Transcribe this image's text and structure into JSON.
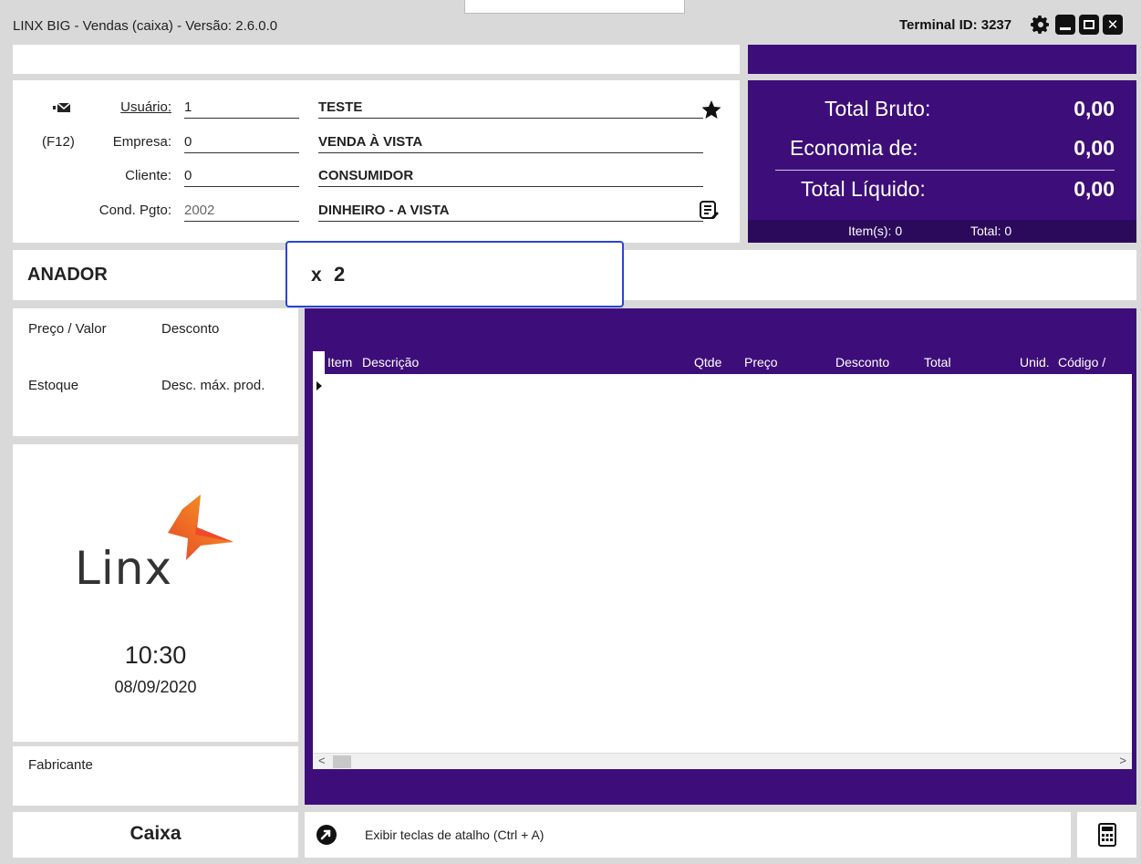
{
  "window": {
    "title": "LINX BIG - Vendas (caixa) - Versão: 2.6.0.0",
    "terminal_id": "Terminal ID: 3237"
  },
  "header": {
    "usuario": {
      "label": "Usuário:",
      "code": "1",
      "desc": "TESTE"
    },
    "empresa": {
      "prefix": "(F12)",
      "label": "Empresa:",
      "code": "0",
      "desc": "VENDA À VISTA"
    },
    "cliente": {
      "label": "Cliente:",
      "code": "0",
      "desc": "CONSUMIDOR"
    },
    "cond_pgto": {
      "label": "Cond. Pgto:",
      "code": "2002",
      "desc": "DINHEIRO - A VISTA"
    }
  },
  "totals": {
    "bruto_label": "Total Bruto:",
    "bruto_value": "0,00",
    "economia_label": "Economia de:",
    "economia_value": "0,00",
    "liquido_label": "Total Líquido:",
    "liquido_value": "0,00",
    "items_label": "Item(s): 0",
    "total_label": "Total: 0"
  },
  "product": {
    "name": "ANADOR",
    "qty_prefix": "x",
    "qty_value": "2"
  },
  "price_panel": {
    "preco": "Preço / Valor",
    "desconto": "Desconto",
    "estoque": "Estoque",
    "desc_max": "Desc. máx. prod."
  },
  "logo": {
    "text": "Linx"
  },
  "clock": {
    "time": "10:30",
    "date": "08/09/2020"
  },
  "fabricante": "Fabricante",
  "grid": {
    "columns": [
      "Item",
      "Descrição",
      "Qtde",
      "Preço",
      "Desconto",
      "Total",
      "Unid.",
      "Código /"
    ]
  },
  "footer": {
    "caixa": "Caixa",
    "shortcut": "Exibir teclas de atalho (Ctrl + A)"
  },
  "colors": {
    "purple": "#3d0e7a",
    "highlight": "#2a45d6"
  }
}
